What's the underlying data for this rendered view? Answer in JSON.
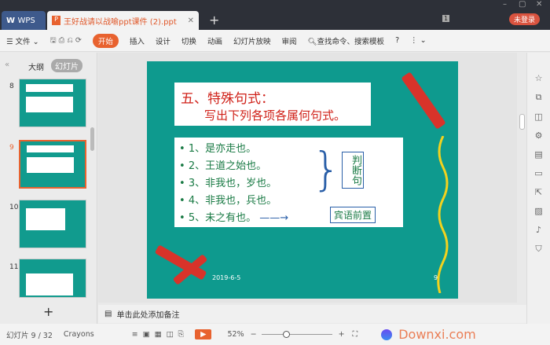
{
  "titlebar": {
    "wps_label": "WPS",
    "doc_tab": "王好战请以战喻ppt课件 (2).ppt",
    "new_tab": "+",
    "login": "未登录",
    "page_badge": "1"
  },
  "toolbar": {
    "file": "文件",
    "tabs": [
      "开始",
      "插入",
      "设计",
      "切换",
      "动画",
      "幻灯片放映",
      "审阅"
    ],
    "search": "查找命令、搜索模板",
    "help": "?"
  },
  "left_panel": {
    "tab_outline": "大纲",
    "tab_slides": "幻灯片",
    "slide_numbers": [
      "8",
      "9",
      "10",
      "11"
    ],
    "selected": "9",
    "add": "+"
  },
  "slide": {
    "title": "五、特殊句式：",
    "subtitle": "写出下列各项各属何句式。",
    "items": [
      "1、是亦走也。",
      "2、王道之始也。",
      "3、非我也，岁也。",
      "4、非我也，兵也。",
      "5、未之有也。"
    ],
    "label1": "判断句",
    "label2": "宾语前置",
    "date": "2019-6-5",
    "page": "9"
  },
  "notes": {
    "placeholder": "单击此处添加备注"
  },
  "status": {
    "slide_info": "幻灯片 9 / 32",
    "theme": "Crayons",
    "zoom": "52%",
    "zoom_fraction": 0.3,
    "watermark": "Downxi.com"
  },
  "colors": {
    "accent": "#e8622f",
    "slide_bg": "#0e9a8e"
  }
}
